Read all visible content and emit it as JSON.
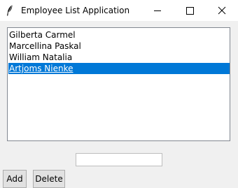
{
  "window": {
    "title": "Employee List Application",
    "icon": "feather-icon",
    "controls": [
      "minimize-icon",
      "maximize-icon",
      "close-icon"
    ]
  },
  "listbox": {
    "items": [
      {
        "label": "Gilberta Carmel",
        "selected": false
      },
      {
        "label": "Marcellina Paskal",
        "selected": false
      },
      {
        "label": "William Natalia",
        "selected": false
      },
      {
        "label": "Artjoms Nienke",
        "selected": true
      }
    ]
  },
  "entry": {
    "value": "",
    "placeholder": ""
  },
  "buttons": {
    "add_label": "Add",
    "delete_label": "Delete"
  },
  "colors": {
    "selection": "#0078d7",
    "window_bg": "#f0f0f0",
    "titlebar_bg": "#ffffff"
  }
}
